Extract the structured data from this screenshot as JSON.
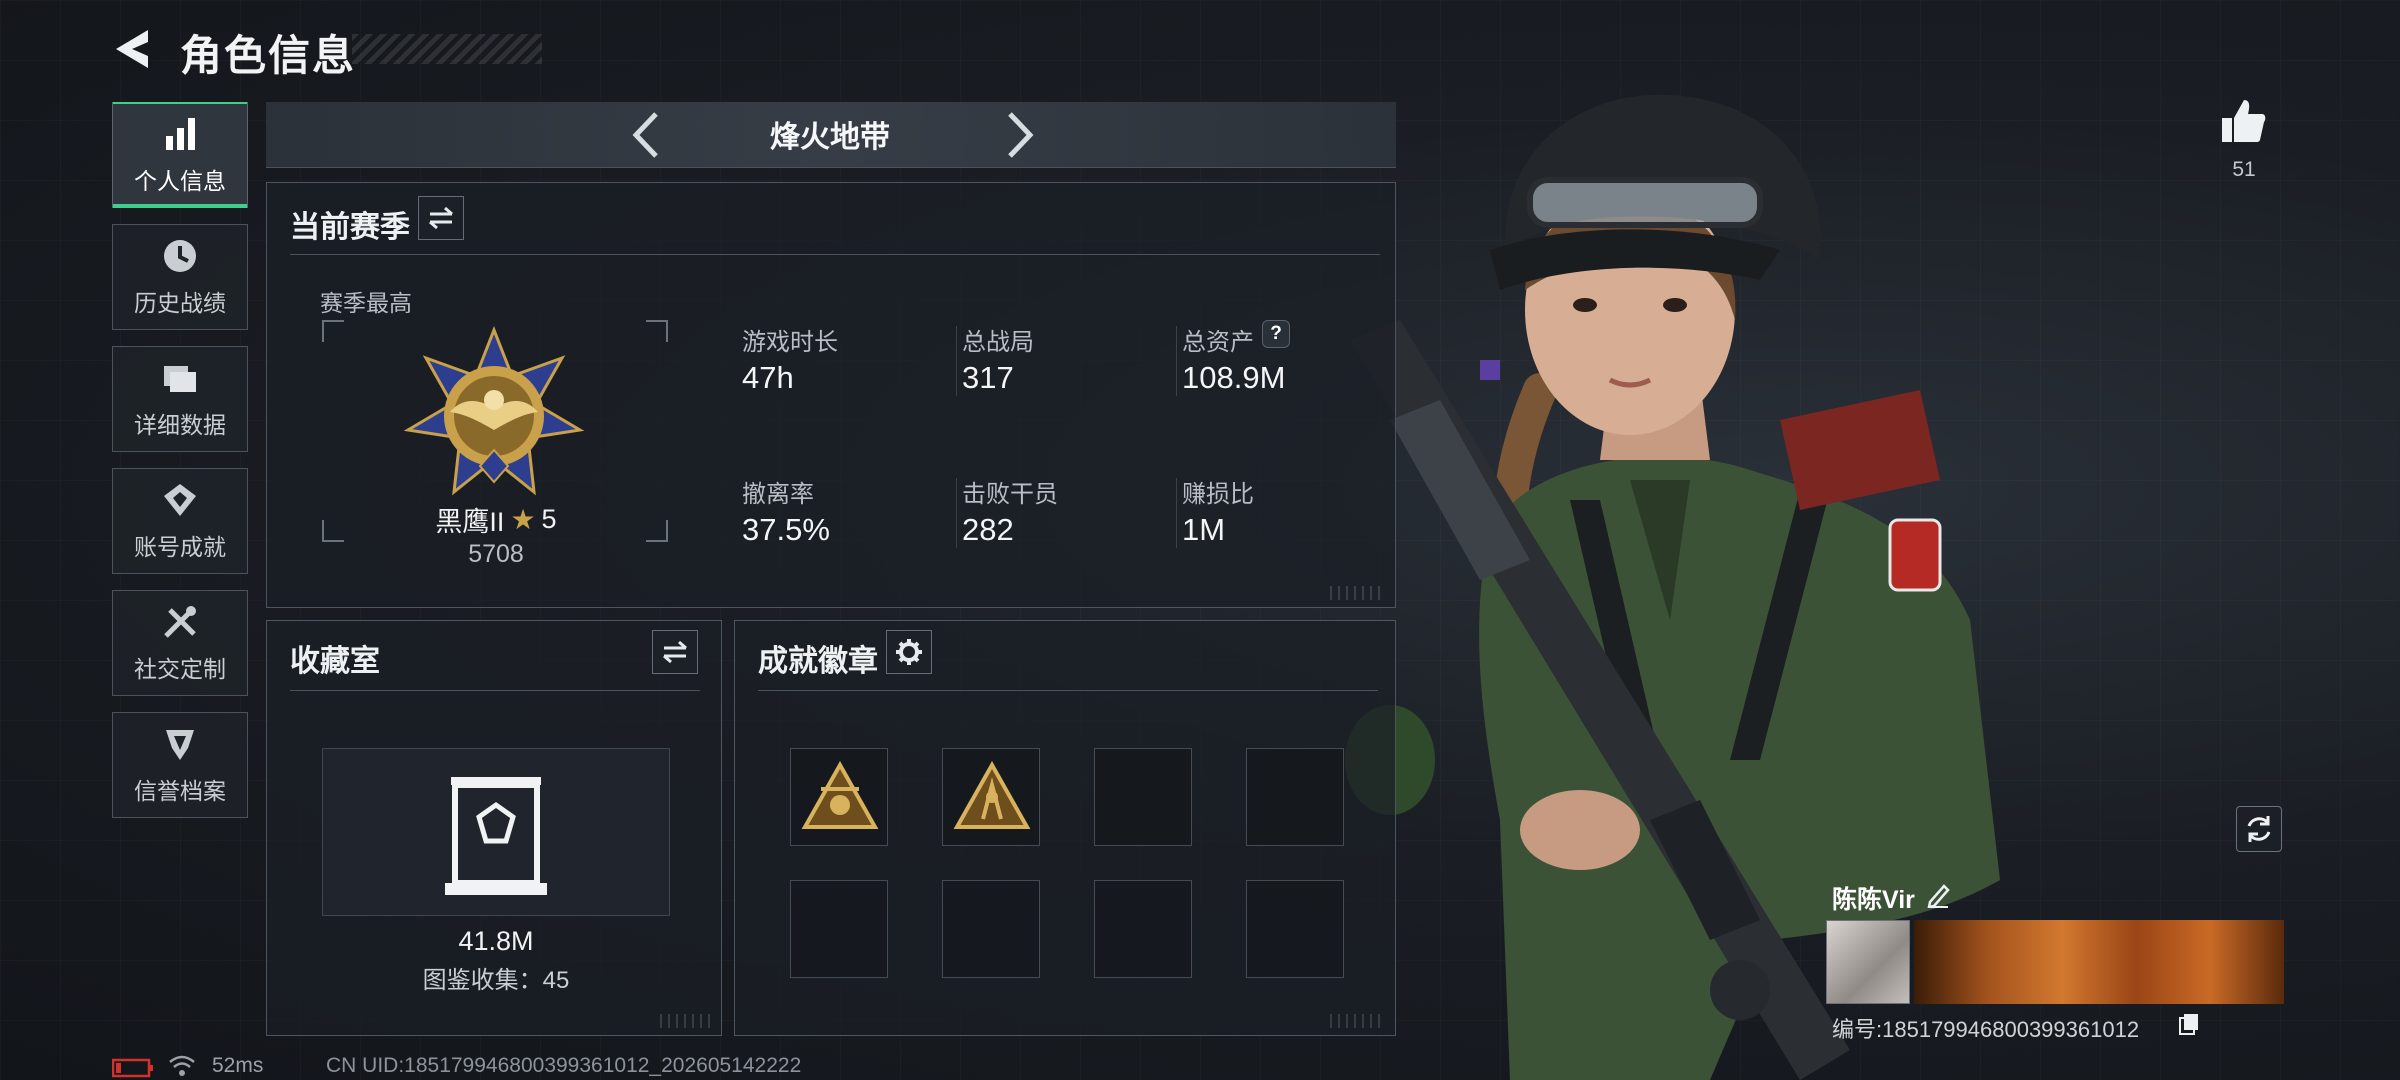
{
  "header": {
    "title": "角色信息"
  },
  "nav": {
    "items": [
      {
        "label": "个人信息",
        "icon": "bar-chart-icon",
        "active": true
      },
      {
        "label": "历史战绩",
        "icon": "history-clock-icon",
        "active": false
      },
      {
        "label": "详细数据",
        "icon": "folder-icon",
        "active": false
      },
      {
        "label": "账号成就",
        "icon": "achievement-icon",
        "active": false
      },
      {
        "label": "社交定制",
        "icon": "tools-icon",
        "active": false
      },
      {
        "label": "信誉档案",
        "icon": "reputation-icon",
        "active": false
      }
    ]
  },
  "mode": {
    "title": "烽火地带"
  },
  "season": {
    "title": "当前赛季",
    "best_label": "赛季最高",
    "rank_name": "黑鹰II",
    "rank_stars": "5",
    "rank_score": "5708",
    "stats": [
      {
        "label": "游戏时长",
        "value": "47h"
      },
      {
        "label": "总战局",
        "value": "317"
      },
      {
        "label": "总资产",
        "value": "108.9M",
        "help": "?"
      },
      {
        "label": "撤离率",
        "value": "37.5%"
      },
      {
        "label": "击败干员",
        "value": "282"
      },
      {
        "label": "赚损比",
        "value": "1M"
      }
    ]
  },
  "collection": {
    "title": "收藏室",
    "value": "41.8M",
    "catalog_label": "图鉴收集：",
    "catalog_count": "45"
  },
  "badges": {
    "title": "成就徽章",
    "slots_filled": 2,
    "slots_total": 8
  },
  "profile": {
    "likes": "51",
    "name": "陈陈Vir",
    "id_label": "编号:",
    "id_value": "1851799468003993610​12"
  },
  "footer": {
    "ping": "52ms",
    "cn_uid": "CN UID:185179946800399361012_202605142222"
  },
  "colors": {
    "accent_green": "#3ecf8e",
    "battery_red": "#d3322c",
    "rank_gold": "#c9a14a",
    "rank_blue": "#2d3e8f"
  }
}
